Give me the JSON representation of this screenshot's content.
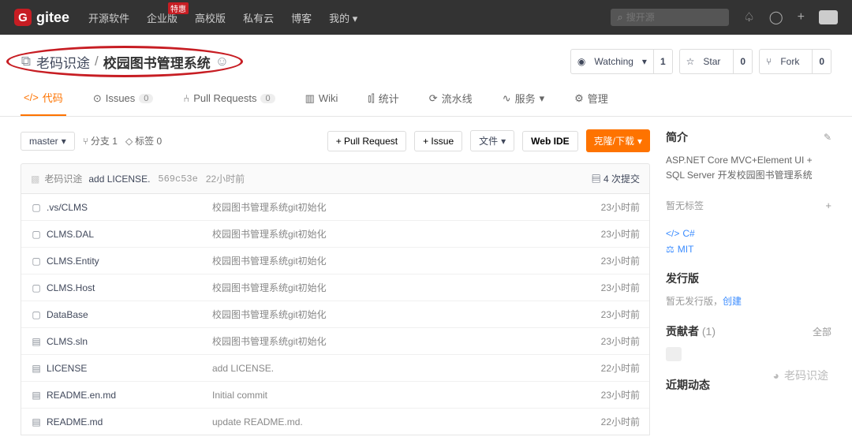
{
  "topnav": {
    "logo_letter": "G",
    "logo_text": "gitee",
    "items": [
      "开源软件",
      "企业版",
      "高校版",
      "私有云",
      "博客",
      "我的"
    ],
    "enterprise_badge": "特惠",
    "search_placeholder": "搜开源"
  },
  "repo": {
    "owner": "老码识途",
    "name": "校园图书管理系统",
    "sep": "/"
  },
  "watch": {
    "label": "Watching",
    "count": "1"
  },
  "star": {
    "label": "Star",
    "count": "0"
  },
  "fork": {
    "label": "Fork",
    "count": "0"
  },
  "tabs": {
    "code": "代码",
    "issues": "Issues",
    "issues_cnt": "0",
    "pr": "Pull Requests",
    "pr_cnt": "0",
    "wiki": "Wiki",
    "stats": "统计",
    "pipeline": "流水线",
    "service": "服务",
    "manage": "管理"
  },
  "toolbar": {
    "branch": "master",
    "branches": "分支 1",
    "tags": "标签 0",
    "pull_request": "+ Pull Request",
    "issue": "+ Issue",
    "files": "文件",
    "webide": "Web IDE",
    "clone": "克隆/下载"
  },
  "commit": {
    "author": "老码识途",
    "message": "add LICENSE.",
    "hash": "569c53e",
    "time": "22小时前",
    "total_label": "4 次提交"
  },
  "files": [
    {
      "icon": "folder",
      "name": ".vs/CLMS",
      "msg": "校园图书管理系统git初始化",
      "time": "23小时前"
    },
    {
      "icon": "folder",
      "name": "CLMS.DAL",
      "msg": "校园图书管理系统git初始化",
      "time": "23小时前"
    },
    {
      "icon": "folder",
      "name": "CLMS.Entity",
      "msg": "校园图书管理系统git初始化",
      "time": "23小时前"
    },
    {
      "icon": "folder",
      "name": "CLMS.Host",
      "msg": "校园图书管理系统git初始化",
      "time": "23小时前"
    },
    {
      "icon": "folder",
      "name": "DataBase",
      "msg": "校园图书管理系统git初始化",
      "time": "23小时前"
    },
    {
      "icon": "file",
      "name": "CLMS.sln",
      "msg": "校园图书管理系统git初始化",
      "time": "23小时前"
    },
    {
      "icon": "file",
      "name": "LICENSE",
      "msg": "add LICENSE.",
      "time": "22小时前"
    },
    {
      "icon": "file",
      "name": "README.en.md",
      "msg": "Initial commit",
      "time": "23小时前"
    },
    {
      "icon": "file",
      "name": "README.md",
      "msg": "update README.md.",
      "time": "22小时前"
    }
  ],
  "sidebar": {
    "intro_h": "简介",
    "desc": "ASP.NET Core MVC+Element UI + SQL Server 开发校园图书管理系统",
    "no_tags": "暂无标签",
    "lang": "C#",
    "license": "MIT",
    "release_h": "发行版",
    "no_release": "暂无发行版，",
    "create": "创建",
    "contrib_h": "贡献者",
    "contrib_cnt": "(1)",
    "all": "全部",
    "recent_h": "近期动态"
  },
  "watermark": "老码识途"
}
